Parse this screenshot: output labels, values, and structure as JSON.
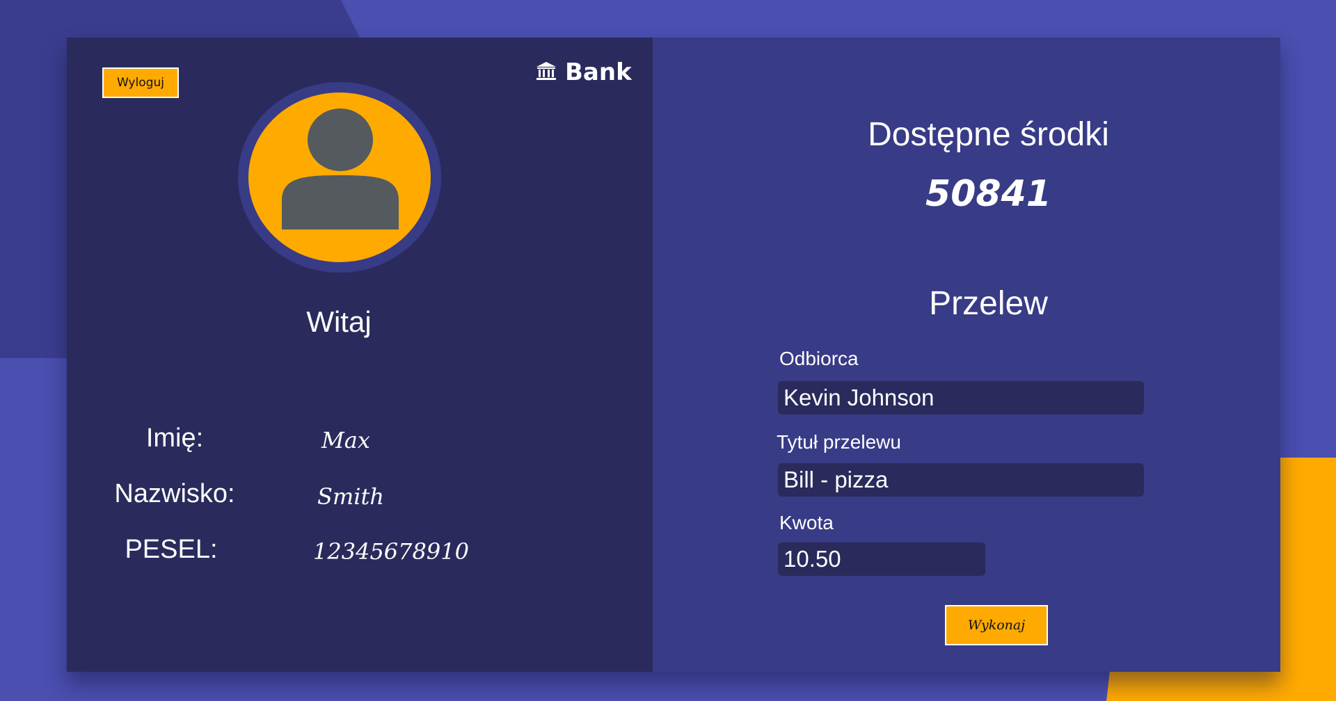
{
  "colors": {
    "accent": "#ffaa00",
    "panel_dark": "#2a2b5c",
    "panel": "#383b85",
    "background": "#4a4fb0"
  },
  "header": {
    "logout_label": "Wyloguj",
    "brand_name": "Bank",
    "brand_icon": "bank-building-icon"
  },
  "profile": {
    "avatar_icon": "user-avatar-icon",
    "welcome": "Witaj",
    "fields": [
      {
        "label": "Imię:",
        "value": "Max"
      },
      {
        "label": "Nazwisko:",
        "value": "Smith"
      },
      {
        "label": "PESEL:",
        "value": "12345678910"
      }
    ]
  },
  "balance": {
    "title": "Dostępne środki",
    "amount": "50841"
  },
  "transfer": {
    "title": "Przelew",
    "recipient": {
      "label": "Odbiorca",
      "value": "Kevin Johnson"
    },
    "transfer_title": {
      "label": "Tytuł przelewu",
      "value": "Bill - pizza"
    },
    "amount": {
      "label": "Kwota",
      "value": "10.50"
    },
    "submit_label": "Wykonaj"
  }
}
